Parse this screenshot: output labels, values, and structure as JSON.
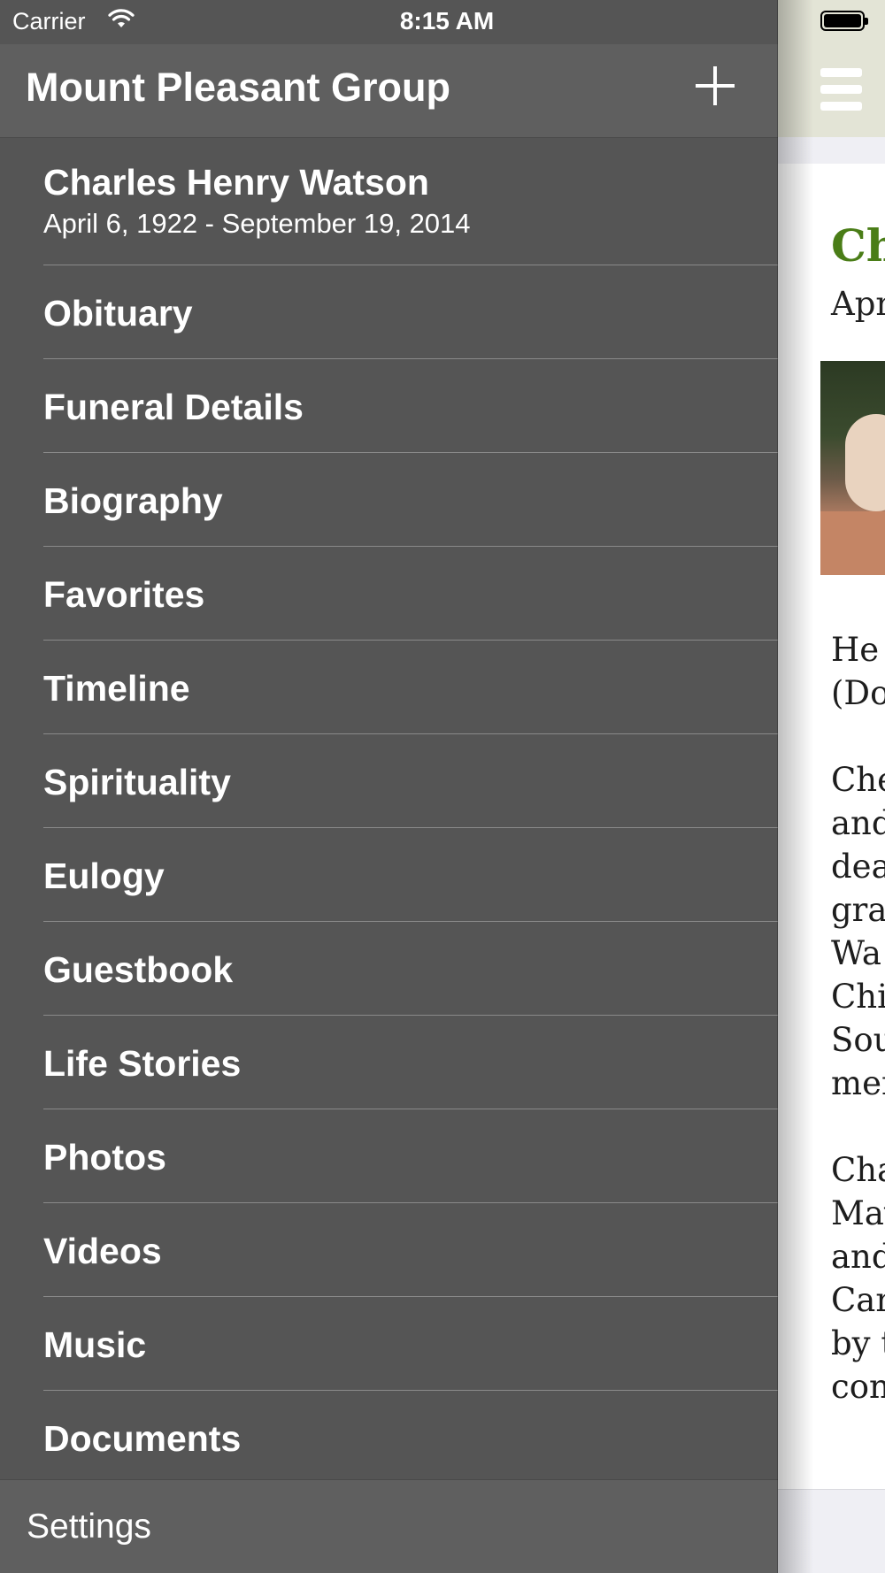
{
  "status_bar": {
    "carrier": "Carrier",
    "time": "8:15 AM"
  },
  "drawer": {
    "title": "Mount Pleasant Group",
    "add_icon": "plus-icon",
    "person": {
      "name": "Charles Henry Watson",
      "dates": "April 6, 1922 - September 19, 2014"
    },
    "items": [
      {
        "label": "Obituary"
      },
      {
        "label": "Funeral Details"
      },
      {
        "label": "Biography"
      },
      {
        "label": "Favorites"
      },
      {
        "label": "Timeline"
      },
      {
        "label": "Spirituality"
      },
      {
        "label": "Eulogy"
      },
      {
        "label": "Guestbook"
      },
      {
        "label": "Life Stories"
      },
      {
        "label": "Photos"
      },
      {
        "label": "Videos"
      },
      {
        "label": "Music"
      },
      {
        "label": "Documents"
      }
    ],
    "settings_label": "Settings"
  },
  "content": {
    "menu_icon": "hamburger-menu-icon",
    "title_partial": "Ch",
    "dates_partial": "Apr",
    "paragraphs": [
      [
        "He",
        "(Do"
      ],
      [
        "Che",
        "and",
        "dea",
        "gra",
        "Wa",
        "Chi",
        "Sou",
        "mer"
      ],
      [
        "Cha",
        "May",
        "and",
        "Car",
        "by t",
        "con"
      ]
    ]
  },
  "colors": {
    "drawer_bg": "#555555",
    "drawer_header_bg": "#5f5f5f",
    "content_nav_bg": "#e3e4d6",
    "title_green": "#4a7d17"
  }
}
